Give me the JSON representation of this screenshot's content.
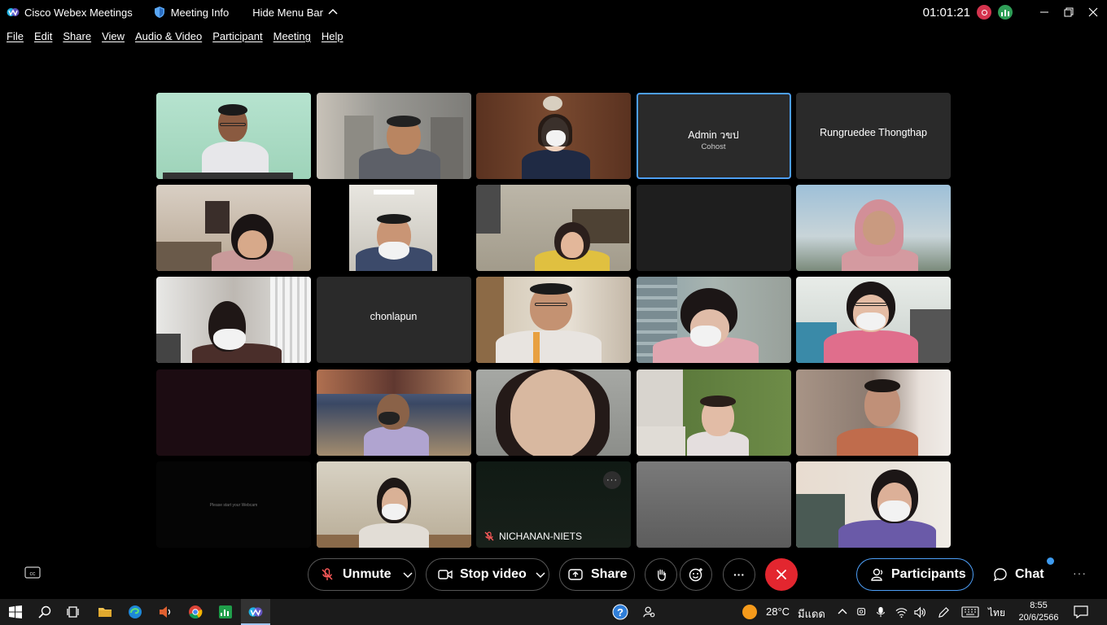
{
  "titlebar": {
    "app_title": "Cisco Webex Meetings",
    "meeting_info": "Meeting Info",
    "hide_menu": "Hide Menu Bar",
    "timer": "01:01:21"
  },
  "menu": [
    "File",
    "Edit",
    "Share",
    "View",
    "Audio & Video",
    "Participant",
    "Meeting",
    "Help"
  ],
  "tiles": {
    "admin_name": "Admin วขป",
    "admin_role": "Cohost",
    "rungruedee_name": "Rungruedee Thongthap",
    "chonlapun_name": "chonlapun",
    "webcam_msg": "Please start your Webcam",
    "nichanan_name": "NICHANAN-NIETS",
    "more": "···"
  },
  "controls": {
    "unmute": "Unmute",
    "stop_video": "Stop video",
    "share": "Share",
    "more": "···",
    "participants": "Participants",
    "chat": "Chat",
    "overflow": "···"
  },
  "taskbar": {
    "weather": "28°C",
    "weather_text": "มีแดด",
    "lang": "ไทย",
    "time": "8:55",
    "date": "20/6/2566"
  },
  "colors": {
    "accent_blue": "#4d9ff8",
    "end_red": "#e3262f",
    "record_red": "#d4344e",
    "stats_green": "#2f9e57"
  }
}
